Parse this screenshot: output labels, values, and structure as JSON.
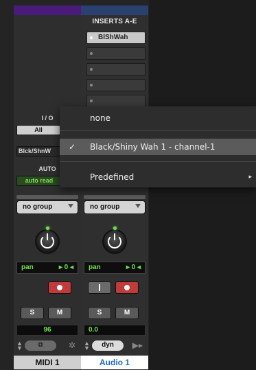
{
  "inserts": {
    "title": "INSERTS A-E",
    "slot1_label": "BlShWah"
  },
  "io": {
    "title": "I / O",
    "input_label": "All",
    "output_label": "Blck/ShnW"
  },
  "auto": {
    "title": "AUTO",
    "mode_label": "auto read"
  },
  "channels": [
    {
      "group_label": "no group",
      "pan_label": "pan",
      "pan_value": "0",
      "solo_label": "S",
      "mute_label": "M",
      "volume": "96",
      "name": "MIDI 1"
    },
    {
      "group_label": "no group",
      "pan_label": "pan",
      "pan_value": "0",
      "solo_label": "S",
      "mute_label": "M",
      "volume": "0.0",
      "dyn_label": "dyn",
      "name": "Audio 1"
    }
  ],
  "menu": {
    "items": [
      {
        "label": "none",
        "checked": false
      },
      {
        "label": "Black/Shiny Wah 1 - channel-1",
        "checked": true
      },
      {
        "label": "Predefined",
        "has_submenu": true
      }
    ],
    "check_glyph": "✓",
    "submenu_glyph": "▸"
  },
  "colors": {
    "midi_track": "#4a1b7a",
    "audio_track": "#2a4170",
    "meter_green": "#6fe04a",
    "record_red": "#c23a3a",
    "audio_name_blue": "#1d6ad8"
  }
}
